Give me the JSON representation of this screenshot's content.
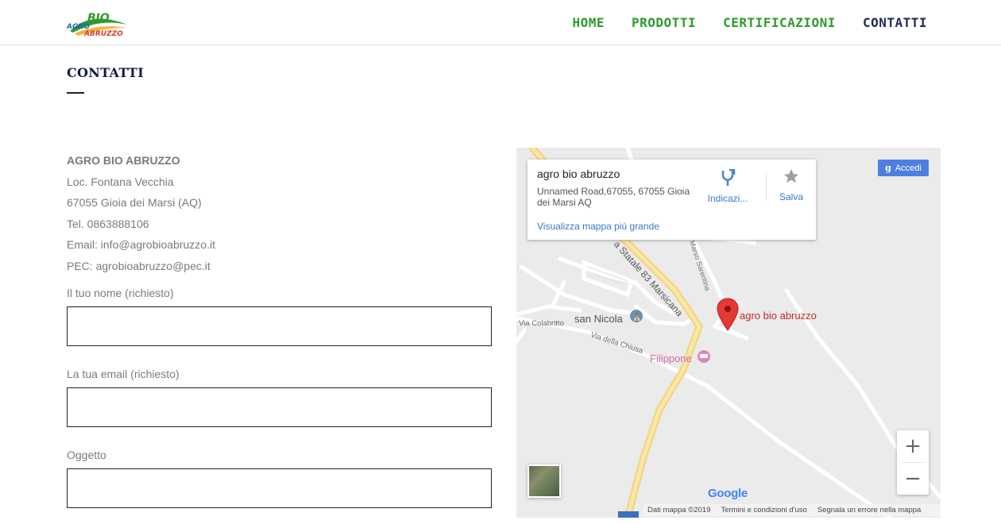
{
  "header": {
    "logo_text_top": "BIO",
    "logo_text_left": "AGRO",
    "logo_text_bottom": "ABRUZZO",
    "nav": [
      {
        "label": "HOME"
      },
      {
        "label": "PRODOTTI"
      },
      {
        "label": "CERTIFICAZIONI"
      },
      {
        "label": "CONTATTI"
      }
    ],
    "colors": {
      "nav_default": "#2e9c2a",
      "nav_active": "#1d2c58"
    }
  },
  "page": {
    "title": "CONTATTI"
  },
  "address": {
    "company": "AGRO BIO ABRUZZO",
    "line1": "Loc. Fontana Vecchia",
    "line2": "67055 Gioia dei Marsi (AQ)",
    "phone": "Tel. 0863888106",
    "email": "Email: info@agrobioabruzzo.it",
    "pec": "PEC: agrobioabruzzo@pec.it"
  },
  "form": {
    "name_label": "Il tuo nome (richiesto)",
    "name_value": "",
    "email_label": "La tua email (richiesto)",
    "email_value": "",
    "subject_label": "Oggetto",
    "subject_value": ""
  },
  "map": {
    "place_name": "agro bio abruzzo",
    "place_address": "Unnamed Road,67055, 67055 Gioia dei Marsi AQ",
    "larger_map_link": "Visualizza mappa più grande",
    "directions_label": "Indicazi...",
    "save_label": "Salva",
    "signin_label": "Accedi",
    "marker_label": "agro bio abruzzo",
    "labels": {
      "road_ss83": "a Statale 83 Marsicana",
      "marso": "Marso Sarentina",
      "san_nicola": "san Nicola",
      "via_colabritto": "Via Colabritto",
      "via_chiusa": "Via della Chiusa",
      "filippone": "Filippone"
    },
    "google_logo": "Google",
    "attribution": {
      "data": "Dati mappa ©2019",
      "terms": "Termini e condizioni d'uso",
      "report": "Segnala un errore nella mappa"
    },
    "zoom_in": "+",
    "zoom_out": "−"
  }
}
